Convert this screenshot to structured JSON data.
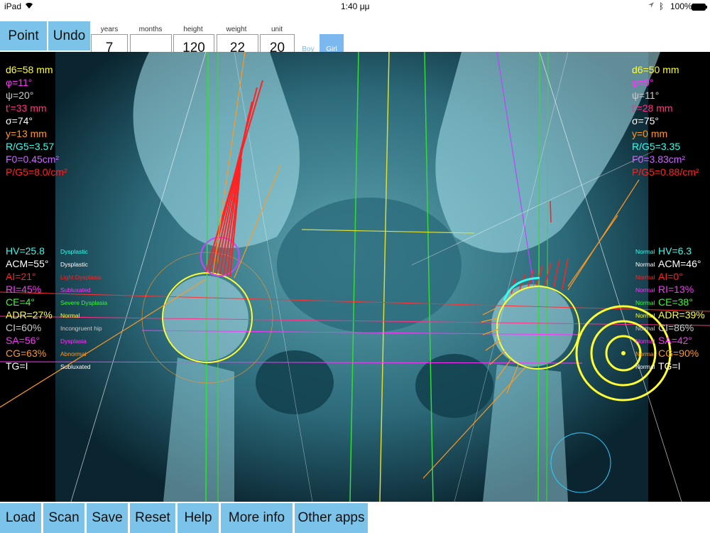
{
  "status": {
    "device": "iPad",
    "time": "1:40 μμ",
    "battery": "100%"
  },
  "toolbar": {
    "point_label": "Point",
    "undo_label": "Undo",
    "fields": [
      {
        "label": "years",
        "value": "7"
      },
      {
        "label": "months",
        "value": ""
      },
      {
        "label": "height",
        "value": "120"
      },
      {
        "label": "weight",
        "value": "22"
      },
      {
        "label": "unit",
        "value": "20"
      }
    ],
    "boy_label": "Boy",
    "girl_label": "Girl",
    "selected_gender": "Girl"
  },
  "left_top": [
    {
      "text": "d6=58 mm",
      "color": "#ffff33"
    },
    {
      "text": "φ=11°",
      "color": "#ff33ff"
    },
    {
      "text": "ψ=20°",
      "color": "#cccccc"
    },
    {
      "text": "t'=33 mm",
      "color": "#ff3388"
    },
    {
      "text": "σ=74°",
      "color": "#ffffff"
    },
    {
      "text": "y=13 mm",
      "color": "#ff9922"
    },
    {
      "text": "R/G5=3.57",
      "color": "#33ffee"
    },
    {
      "text": "F0=0.45cm²",
      "color": "#cc66ff"
    },
    {
      "text": "P/G5=8.0/cm²",
      "color": "#ff2222"
    }
  ],
  "right_top": [
    {
      "text": "d6=50 mm",
      "color": "#ffff33"
    },
    {
      "text": "φ=9°",
      "color": "#ff33ff"
    },
    {
      "text": "ψ=11°",
      "color": "#cccccc"
    },
    {
      "text": "t'=28 mm",
      "color": "#ff3388"
    },
    {
      "text": "σ=75°",
      "color": "#ffffff"
    },
    {
      "text": "y=0 mm",
      "color": "#ff9922"
    },
    {
      "text": "R/G5=3.35",
      "color": "#33ffee"
    },
    {
      "text": "F0=3.83cm²",
      "color": "#cc66ff"
    },
    {
      "text": "P/G5=0.88/cm²",
      "color": "#ff2222"
    }
  ],
  "left_indices": [
    {
      "text": "HV=25.8",
      "status": "Dysplastic",
      "color": "#33ffee"
    },
    {
      "text": "ACM=55°",
      "status": "Dysplastic",
      "color": "#ffffff"
    },
    {
      "text": "AI=21°",
      "status": "Light Dysplasia",
      "color": "#ff2222"
    },
    {
      "text": "RI=45%",
      "status": "Subluxated",
      "color": "#ff33ff"
    },
    {
      "text": "CE=4°",
      "status": "Severe Dysplasia",
      "color": "#33ff33"
    },
    {
      "text": "ADR=27%",
      "status": "Normal",
      "color": "#ffff33"
    },
    {
      "text": "CI=60%",
      "status": "Incongruent hip",
      "color": "#cccccc"
    },
    {
      "text": "SA=56°",
      "status": "Dysplasia",
      "color": "#ff33ff"
    },
    {
      "text": "CG=63%",
      "status": "Abnormal",
      "color": "#ff9922"
    },
    {
      "text": "TG=I",
      "status": "Subluxated",
      "color": "#ffffff"
    }
  ],
  "right_indices": [
    {
      "text": "HV=6.3",
      "status": "Normal",
      "color": "#33ffee"
    },
    {
      "text": "ACM=46°",
      "status": "Normal",
      "color": "#ffffff"
    },
    {
      "text": "AI=0°",
      "status": "Normal",
      "color": "#ff2222"
    },
    {
      "text": "RI=13%",
      "status": "Normal",
      "color": "#ff33ff"
    },
    {
      "text": "CE=38°",
      "status": "Normal",
      "color": "#33ff33"
    },
    {
      "text": "ADR=39%",
      "status": "Normal",
      "color": "#ffff33"
    },
    {
      "text": "CI=86%",
      "status": "Normal",
      "color": "#cccccc"
    },
    {
      "text": "SA=42°",
      "status": "Normal",
      "color": "#ff33ff"
    },
    {
      "text": "CG=90%",
      "status": "Normal",
      "color": "#ff9922"
    },
    {
      "text": "TG=I",
      "status": "Normal",
      "color": "#ffffff"
    }
  ],
  "bottom": {
    "load": "Load",
    "scan": "Scan",
    "save": "Save",
    "reset": "Reset",
    "help": "Help",
    "more_info": "More info",
    "other_apps": "Other apps"
  }
}
